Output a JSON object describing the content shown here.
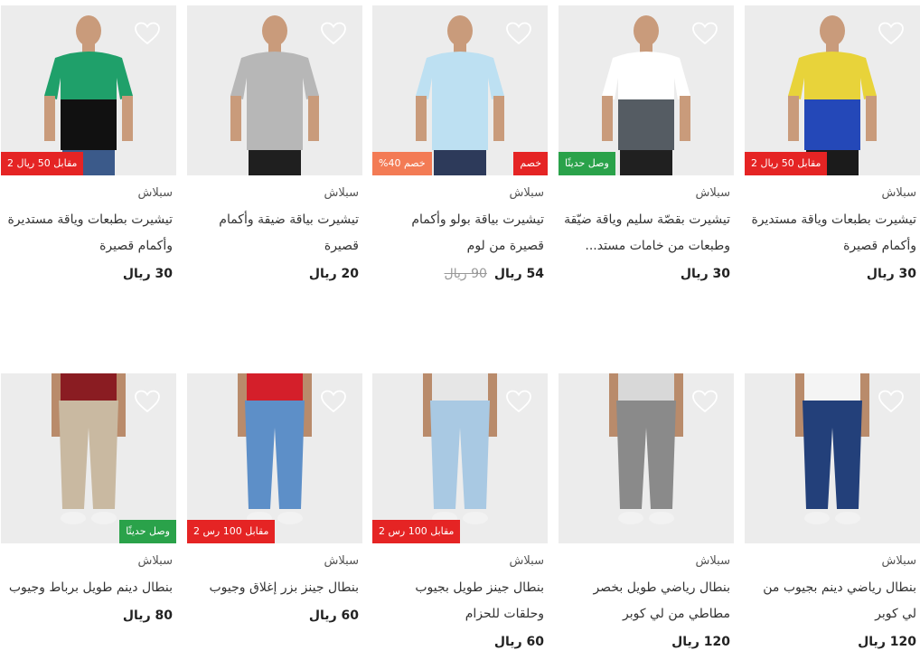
{
  "heart_icon": "heart-outline-icon",
  "colors": {
    "badge_red": "#e52424",
    "badge_green": "#2aa24a",
    "badge_orange": "#f37b55"
  },
  "products": [
    {
      "brand": "سبلاش",
      "title": "تيشيرت بطبعات وياقة مستديرة وأكمام قصيرة",
      "price": "30 ريال",
      "old_price": "",
      "tags": [
        {
          "text": "2 مقابل 50 ريال",
          "color": "red",
          "side": "l"
        }
      ]
    },
    {
      "brand": "سبلاش",
      "title": "تيشيرت بقصّة سليم وياقة ضيّقة وطبعات من خامات مستد...",
      "price": "30 ريال",
      "old_price": "",
      "tags": [
        {
          "text": "وصل حديثًا",
          "color": "green",
          "side": "l"
        }
      ]
    },
    {
      "brand": "سبلاش",
      "title": "تيشيرت بياقة بولو وأكمام قصيرة من لوم",
      "price": "54 ريال",
      "old_price": "90 ريال",
      "tags": [
        {
          "text": "%40 خصم",
          "color": "orange",
          "side": "l"
        },
        {
          "text": "خصم",
          "color": "red",
          "side": "r"
        }
      ]
    },
    {
      "brand": "سبلاش",
      "title": "تيشيرت بياقة ضيقة وأكمام قصيرة",
      "price": "20 ريال",
      "old_price": "",
      "tags": []
    },
    {
      "brand": "سبلاش",
      "title": "تيشيرت بطبعات وياقة مستديرة وأكمام قصيرة",
      "price": "30 ريال",
      "old_price": "",
      "tags": [
        {
          "text": "2 مقابل 50 ريال",
          "color": "red",
          "side": "l"
        }
      ]
    },
    {
      "brand": "سبلاش",
      "title": "بنطال رياضي دينم بجيوب من لي كوبر",
      "price": "120 ريال",
      "old_price": "",
      "tags": []
    },
    {
      "brand": "سبلاش",
      "title": "بنطال رياضي طويل بخصر مطاطي من لي كوبر",
      "price": "120 ريال",
      "old_price": "",
      "tags": []
    },
    {
      "brand": "سبلاش",
      "title": "بنطال جينز طويل بجيوب وحلقات للحزام",
      "price": "60 ريال",
      "old_price": "",
      "tags": [
        {
          "text": "2 مقابل 100 رس",
          "color": "red",
          "side": "l"
        }
      ]
    },
    {
      "brand": "سبلاش",
      "title": "بنطال جينز بزر إغلاق وجيوب",
      "price": "60 ريال",
      "old_price": "",
      "tags": [
        {
          "text": "2 مقابل 100 رس",
          "color": "red",
          "side": "l"
        }
      ]
    },
    {
      "brand": "سبلاش",
      "title": "بنطال دينم طويل برباط وجيوب",
      "price": "80 ريال",
      "old_price": "",
      "tags": [
        {
          "text": "وصل حديثًا",
          "color": "green",
          "side": "r"
        }
      ]
    }
  ]
}
